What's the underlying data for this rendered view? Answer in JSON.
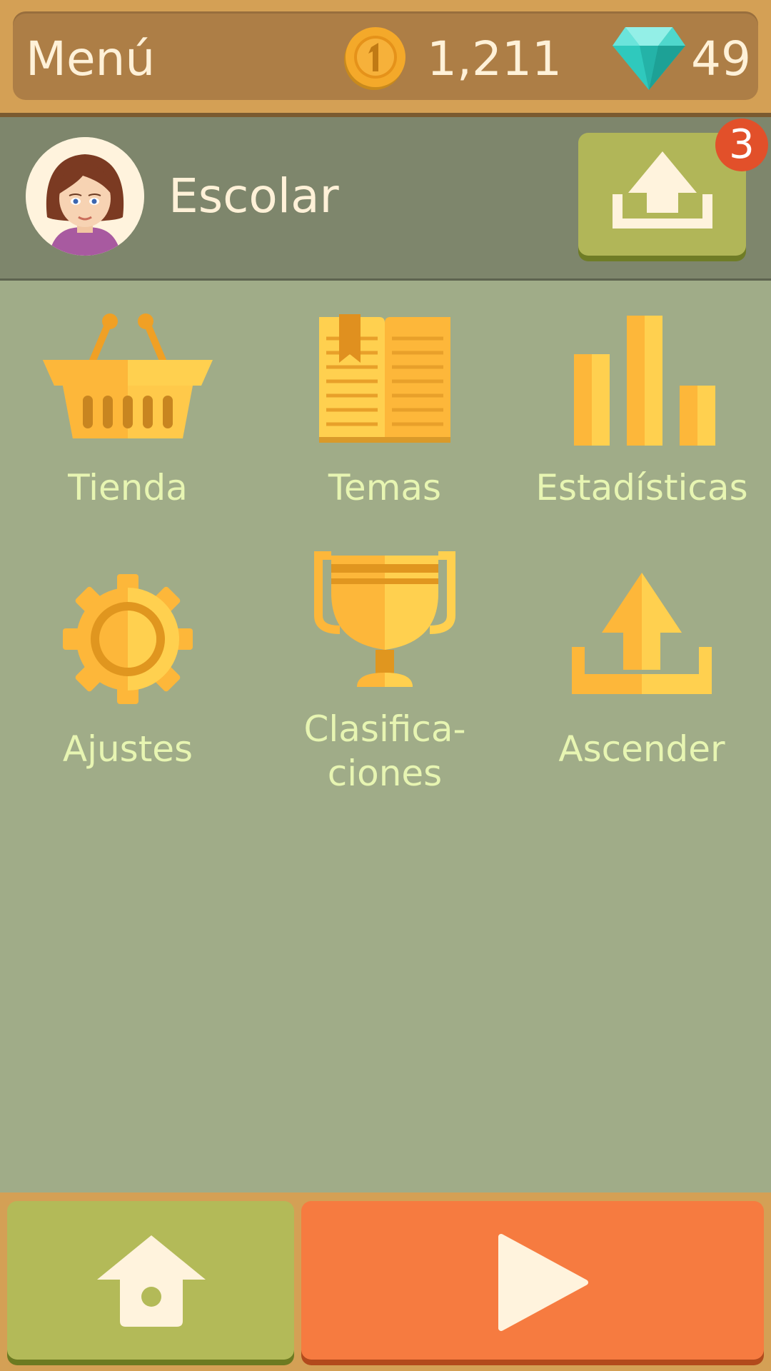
{
  "header": {
    "title": "Menú",
    "coins": "1,211",
    "gems": "49",
    "coin_icon": "coin-icon",
    "gem_icon": "diamond-icon"
  },
  "profile": {
    "name": "Escolar",
    "avatar_icon": "avatar-girl",
    "upload_badge": "3"
  },
  "menu": {
    "items": [
      {
        "label": "Tienda",
        "icon": "basket-icon"
      },
      {
        "label": "Temas",
        "icon": "book-icon"
      },
      {
        "label": "Estadísticas",
        "icon": "bar-chart-icon"
      },
      {
        "label": "Ajustes",
        "icon": "gear-icon"
      },
      {
        "label": "Clasifica-\nciones",
        "icon": "trophy-icon"
      },
      {
        "label": "Ascender",
        "icon": "upload-icon"
      }
    ]
  },
  "footer": {
    "home_icon": "home-icon",
    "play_icon": "play-icon"
  },
  "colors": {
    "background": "#a0ac88",
    "accent_orange": "#f67b40",
    "accent_green": "#b3ba58",
    "icon_gold": "#fdb73a",
    "label": "#e7f5b2"
  }
}
